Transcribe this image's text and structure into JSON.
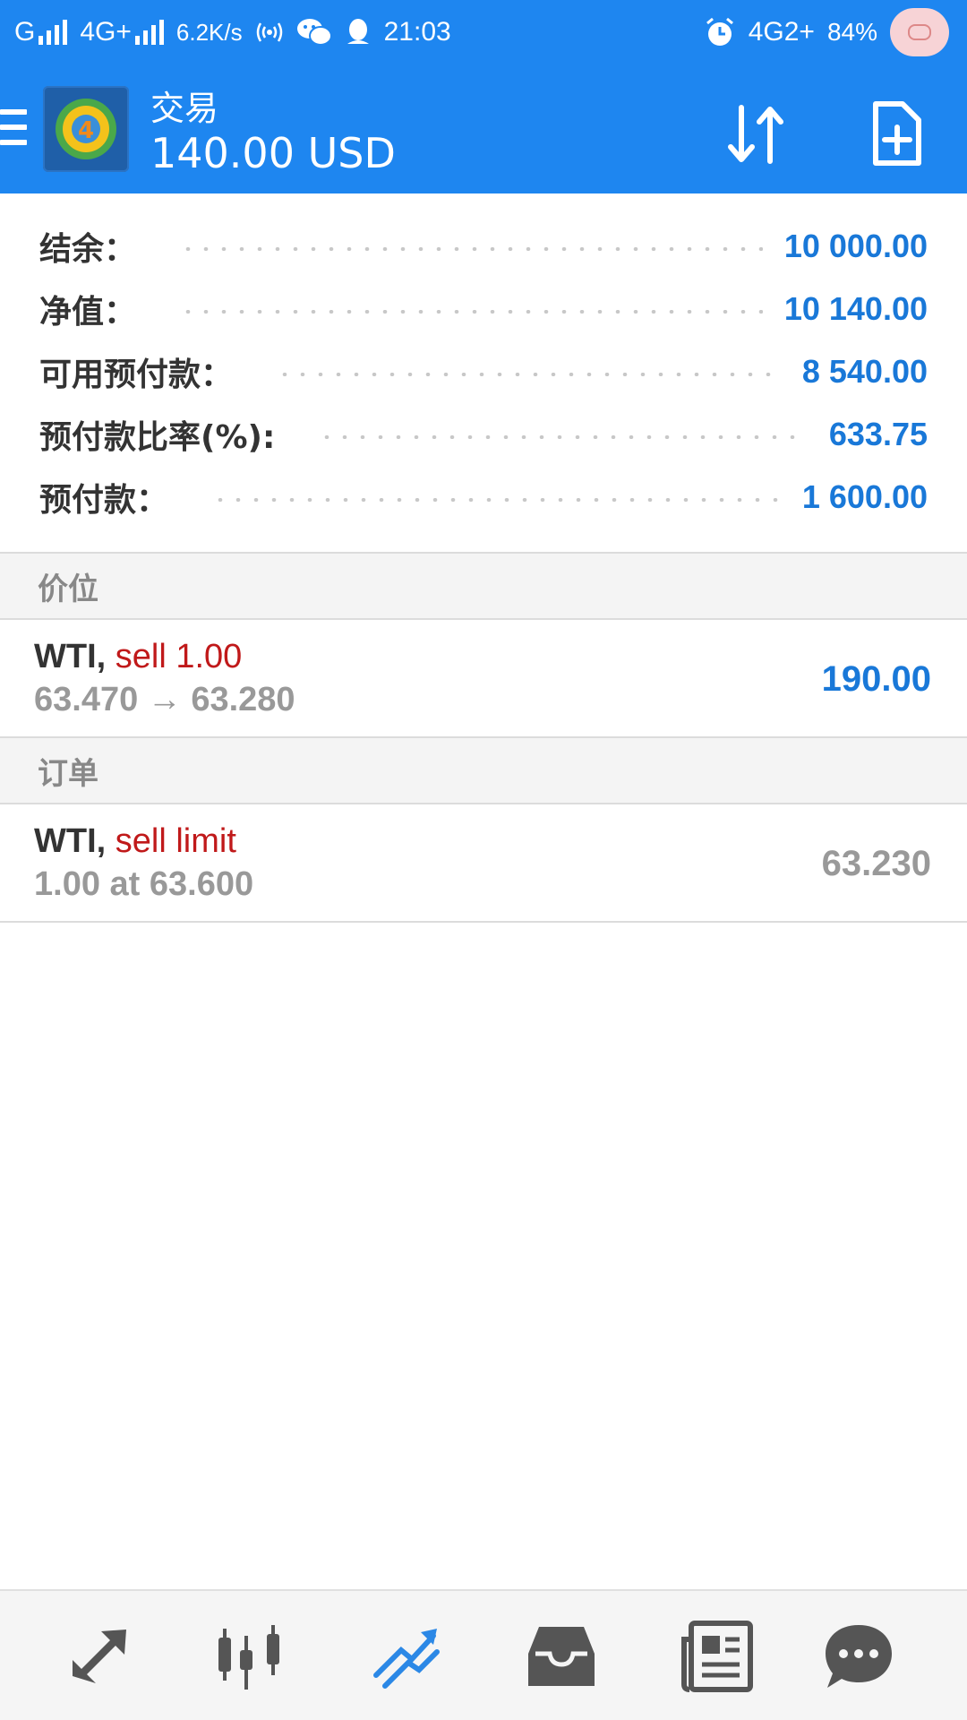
{
  "status_bar": {
    "carrier1": "G",
    "carrier2": "4G+",
    "speed": "6.2K/s",
    "time": "21:03",
    "network": "4G2+",
    "battery": "84%"
  },
  "app_bar": {
    "title": "交易",
    "balance": "140.00 USD"
  },
  "summary": [
    {
      "label": "结余：",
      "value": "10 000.00"
    },
    {
      "label": "净值：",
      "value": "10 140.00"
    },
    {
      "label": "可用预付款：",
      "value": "8 540.00"
    },
    {
      "label": "预付款比率(%):",
      "value": "633.75"
    },
    {
      "label": "预付款：",
      "value": "1 600.00"
    }
  ],
  "positions": {
    "header": "价位",
    "items": [
      {
        "symbol": "WTI,",
        "side": "sell 1.00",
        "detail": "63.470 → 63.280",
        "value": "190.00"
      }
    ]
  },
  "orders": {
    "header": "订单",
    "items": [
      {
        "symbol": "WTI,",
        "side": "sell limit",
        "detail": "1.00 at 63.600",
        "value": "63.230"
      }
    ]
  },
  "bottom_nav": {
    "items": [
      "quotes-icon",
      "chart-icon",
      "trade-icon",
      "history-icon",
      "news-icon",
      "chat-icon"
    ],
    "active": "trade-icon"
  },
  "colors": {
    "header_blue": "#1e86f0",
    "value_blue": "#1978d8",
    "sell_red": "#c0191a"
  }
}
